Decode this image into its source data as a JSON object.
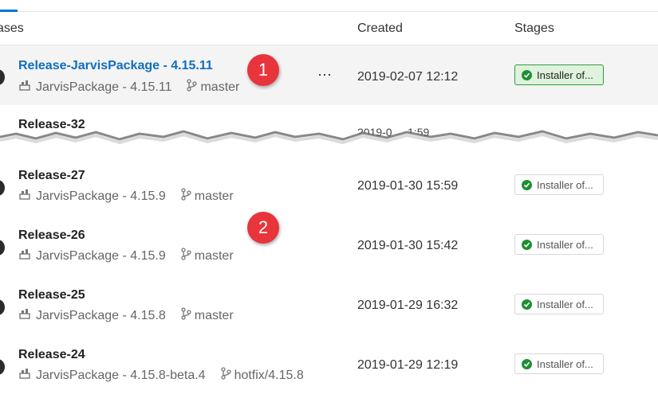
{
  "header": {
    "col_name": "ases",
    "col_created": "Created",
    "col_stages": "Stages"
  },
  "partial_row": {
    "title": "Release-32",
    "created_fragment": "2019-0 ... 1:59"
  },
  "rows": [
    {
      "title": "Release-JarvisPackage - 4.15.11",
      "artifact": "JarvisPackage - 4.15.11",
      "branch": "master",
      "created": "2019-02-07 12:12",
      "stage": "Installer of...",
      "selected": true
    },
    {
      "title": "Release-27",
      "artifact": "JarvisPackage - 4.15.9",
      "branch": "master",
      "created": "2019-01-30 15:59",
      "stage": "Installer of..."
    },
    {
      "title": "Release-26",
      "artifact": "JarvisPackage - 4.15.9",
      "branch": "master",
      "created": "2019-01-30 15:42",
      "stage": "Installer of..."
    },
    {
      "title": "Release-25",
      "artifact": "JarvisPackage - 4.15.8",
      "branch": "master",
      "created": "2019-01-29 16:32",
      "stage": "Installer of..."
    },
    {
      "title": "Release-24",
      "artifact": "JarvisPackage - 4.15.8-beta.4",
      "branch": "hotfix/4.15.8",
      "created": "2019-01-29 12:19",
      "stage": "Installer of..."
    }
  ],
  "more_label": "⋯",
  "callouts": {
    "one": "1",
    "two": "2"
  },
  "colors": {
    "link": "#106ebe",
    "success": "#1d8f32",
    "badge": "#e8343b",
    "selected_bg": "#f4f4f4"
  }
}
